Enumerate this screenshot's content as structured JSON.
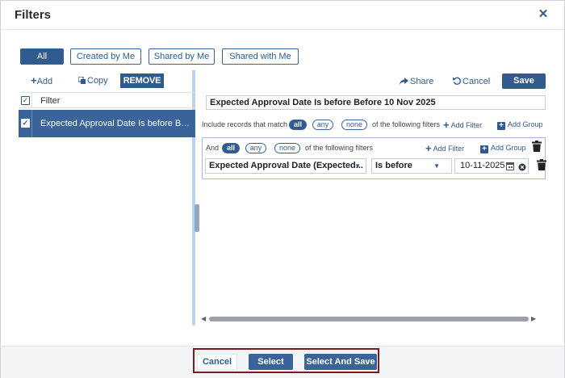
{
  "dialog": {
    "title": "Filters"
  },
  "tabs": [
    {
      "label": "All",
      "active": true
    },
    {
      "label": "Created by Me",
      "active": false
    },
    {
      "label": "Shared by Me",
      "active": false
    },
    {
      "label": "Shared with Me",
      "active": false
    }
  ],
  "left_toolbar": {
    "add_label": "Add",
    "copy_label": "Copy",
    "remove_label": "REMOVE"
  },
  "filter_list": {
    "header": "Filter",
    "items": [
      {
        "label": "Expected Approval Date Is before Before 10 Nov 2025",
        "checked": true,
        "selected": true
      }
    ]
  },
  "right_toolbar": {
    "share_label": "Share",
    "cancel_label": "Cancel",
    "save_label": "Save"
  },
  "editor": {
    "filter_name": "Expected Approval Date Is before Before 10 Nov 2025",
    "outer": {
      "prefix": "Include records that match",
      "options": [
        "all",
        "any",
        "none"
      ],
      "selected": "all",
      "suffix": "of the following filters",
      "add_filter_label": "Add Filter",
      "add_group_label": "Add Group"
    },
    "group": {
      "prefix": "And",
      "options": [
        "all",
        "any",
        "none"
      ],
      "selected": "all",
      "suffix": "of the following filters",
      "add_filter_label": "Add Filter",
      "add_group_label": "Add Group",
      "condition": {
        "field": "Expected Approval Date (Expected...",
        "operator": "Is before",
        "value": "10-11-2025"
      }
    }
  },
  "footer": {
    "cancel_label": "Cancel",
    "select_label": "Select",
    "select_and_save_label": "Select And Save"
  },
  "colors": {
    "primary": "#2f5b8f",
    "button": "#3a6499",
    "splitter": "#b9d2ee",
    "highlight_border": "#7a1a22"
  }
}
